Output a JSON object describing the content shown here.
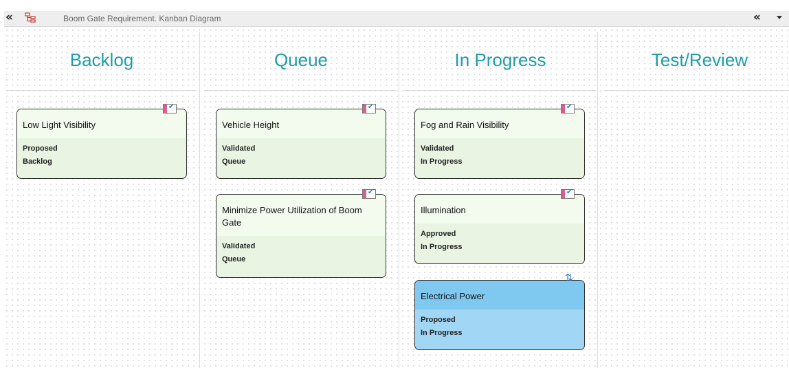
{
  "window": {
    "title": "Boom Gate Requirement.  Kanban Diagram",
    "collapse_left_glyph": "«",
    "collapse_right_glyph": "«",
    "tree_icon": "tree-diagram-icon"
  },
  "columns": [
    {
      "title": "Backlog"
    },
    {
      "title": "Queue"
    },
    {
      "title": "In Progress"
    },
    {
      "title": "Test/Review"
    }
  ],
  "cards": {
    "low_light": {
      "name": "Low Light Visibility",
      "status": "Proposed",
      "phase": "Backlog",
      "icon": "requirement-icon"
    },
    "vehicle_height": {
      "name": "Vehicle Height",
      "status": "Validated",
      "phase": "Queue",
      "icon": "requirement-icon"
    },
    "min_power": {
      "name": "Minimize Power Utilization of Boom Gate",
      "status": "Validated",
      "phase": "Queue",
      "icon": "requirement-icon"
    },
    "fog_rain": {
      "name": "Fog and Rain Visibility",
      "status": "Validated",
      "phase": "In Progress",
      "icon": "requirement-icon"
    },
    "illumination": {
      "name": "Illumination",
      "status": "Approved",
      "phase": "In Progress",
      "icon": "requirement-icon"
    },
    "electrical_power": {
      "name": "Electrical Power",
      "status": "Proposed",
      "phase": "In Progress",
      "icon": "sync-icon"
    }
  },
  "colors": {
    "column_title": "#1f9ca8",
    "card_green": "#e9f5e2",
    "card_blue": "#a2d6f5",
    "card_border": "#2e2e2e"
  }
}
